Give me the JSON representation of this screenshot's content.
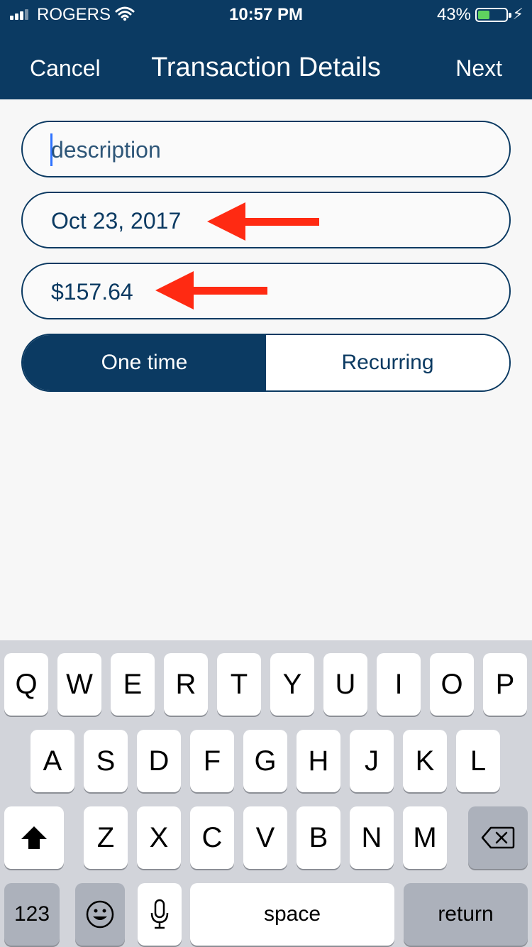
{
  "status_bar": {
    "carrier": "ROGERS",
    "time": "10:57 PM",
    "battery_percent": "43%",
    "battery_level": 0.43,
    "battery_color": "#5fd35f"
  },
  "nav": {
    "cancel_label": "Cancel",
    "title": "Transaction Details",
    "next_label": "Next",
    "bg_color": "#0b3a62"
  },
  "form": {
    "description": {
      "value": "",
      "placeholder": "description"
    },
    "date": {
      "value": "Oct 23, 2017"
    },
    "amount": {
      "value": "$157.64"
    },
    "frequency": {
      "options": [
        "One time",
        "Recurring"
      ],
      "selected": "One time"
    }
  },
  "annotations": {
    "arrow_color": "#ff2a12",
    "icon": "red-arrow-icon"
  },
  "keyboard": {
    "row1": [
      "Q",
      "W",
      "E",
      "R",
      "T",
      "Y",
      "U",
      "I",
      "O",
      "P"
    ],
    "row2": [
      "A",
      "S",
      "D",
      "F",
      "G",
      "H",
      "J",
      "K",
      "L"
    ],
    "row3": [
      "Z",
      "X",
      "C",
      "V",
      "B",
      "N",
      "M"
    ],
    "numbers_label": "123",
    "space_label": "space",
    "return_label": "return",
    "icons": [
      "shift-icon",
      "backspace-icon",
      "emoji-icon",
      "microphone-icon"
    ]
  }
}
